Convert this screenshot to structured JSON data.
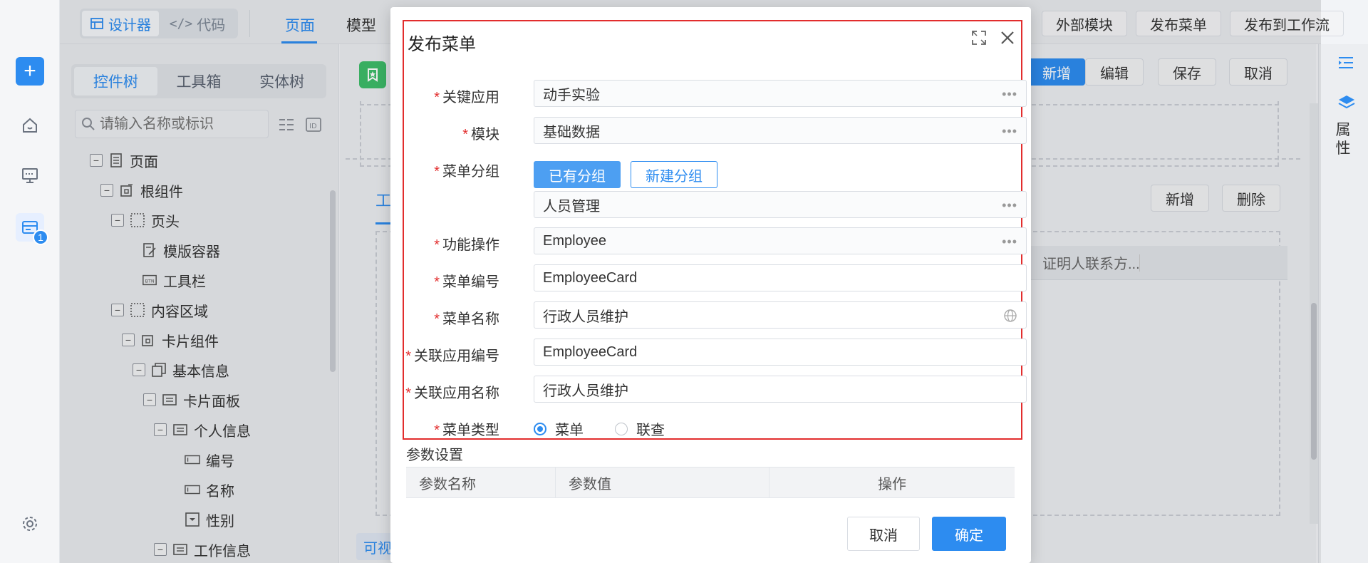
{
  "rail": {
    "badge": "1"
  },
  "topbar": {
    "seg": [
      "设计器",
      "代码"
    ],
    "tabs": [
      "页面",
      "模型"
    ],
    "right_buttons": [
      "外部模块",
      "发布菜单",
      "发布到工作流"
    ]
  },
  "left_panel": {
    "tabs": [
      "控件树",
      "工具箱",
      "实体树"
    ],
    "search_placeholder": "请输入名称或标识",
    "tree": [
      "页面",
      "根组件",
      "页头",
      "模版容器",
      "工具栏",
      "内容区域",
      "卡片组件",
      "基本信息",
      "卡片面板",
      "个人信息",
      "编号",
      "名称",
      "性别",
      "工作信息"
    ]
  },
  "canvas": {
    "top_buttons": [
      "新增",
      "编辑",
      "保存",
      "取消"
    ],
    "inner_buttons": [
      "新增",
      "删除"
    ],
    "tab_partial": "工",
    "column_header": "证明人联系方...",
    "bottom_tab": "可视"
  },
  "right_rail": {
    "label": "属性"
  },
  "modal": {
    "title": "发布菜单",
    "fields": {
      "key_app": {
        "label": "关键应用",
        "value": "动手实验"
      },
      "module": {
        "label": "模块",
        "value": "基础数据"
      },
      "menu_group": {
        "label": "菜单分组",
        "existing": "已有分组",
        "new": "新建分组",
        "value": "人员管理"
      },
      "func_op": {
        "label": "功能操作",
        "value": "Employee"
      },
      "menu_code": {
        "label": "菜单编号",
        "value": "EmployeeCard"
      },
      "menu_name": {
        "label": "菜单名称",
        "value": "行政人员维护"
      },
      "rel_app_code": {
        "label": "关联应用编号",
        "value": "EmployeeCard"
      },
      "rel_app_name": {
        "label": "关联应用名称",
        "value": "行政人员维护"
      },
      "menu_type": {
        "label": "菜单类型",
        "opt1": "菜单",
        "opt2": "联查"
      }
    },
    "params_title": "参数设置",
    "params_cols": [
      "参数名称",
      "参数值",
      "操作"
    ],
    "cancel": "取消",
    "ok": "确定"
  }
}
